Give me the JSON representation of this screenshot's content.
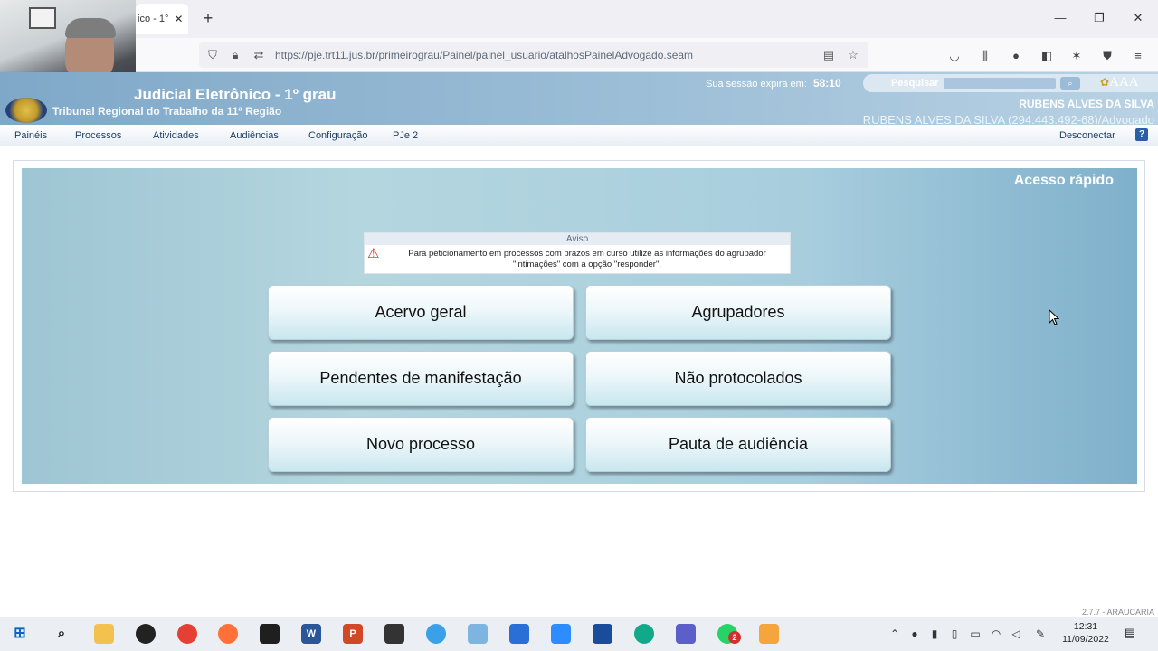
{
  "browser": {
    "tab_title": "ico - 1°",
    "tab_close": "✕",
    "new_tab": "+",
    "url": "https://pje.trt11.jus.br/primeirograu/Painel/painel_usuario/atalhosPainelAdvogado.seam",
    "window_controls": {
      "minimize": "—",
      "restore": "❐",
      "close": "✕"
    }
  },
  "header": {
    "title": "Judicial Eletrônico - 1º grau",
    "subtitle": "Tribunal Regional do Trabalho da 11ª Região",
    "session_label": "Sua sessão expira em:",
    "session_time": "58:10",
    "search_label": "Pesquisar",
    "font_controls": "AAA",
    "user_name": "RUBENS ALVES DA SILVA",
    "user_role": "RUBENS ALVES DA SILVA (294.443.492-68)/Advogado"
  },
  "menu": {
    "items": [
      "Painéis",
      "Processos",
      "Atividades",
      "Audiências",
      "Configuração",
      "PJe 2"
    ],
    "disconnect": "Desconectar",
    "help": "?"
  },
  "panel": {
    "title": "Acesso rápido",
    "aviso_title": "Aviso",
    "aviso_text": "Para peticionamento em processos com prazos em curso utilize as informações do agrupador \"intimações\" com a opção \"responder\".",
    "buttons": [
      "Acervo geral",
      "Agrupadores",
      "Pendentes de manifestação",
      "Não protocolados",
      "Novo processo",
      "Pauta de audiência"
    ]
  },
  "footer": {
    "version": "2.7.7 - ARAUCARIA"
  },
  "taskbar": {
    "time": "12:31",
    "date": "11/09/2022",
    "badge": "2"
  },
  "colors": {
    "header_bg": "#7fa8c8",
    "panel_bg": "#a8cede",
    "accent": "#2a5fa8"
  }
}
